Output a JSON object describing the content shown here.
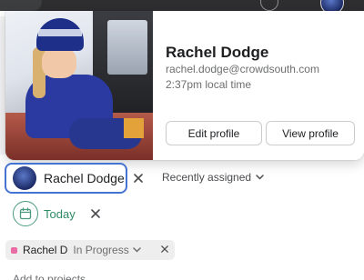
{
  "profile_card": {
    "name": "Rachel Dodge",
    "email": "rachel.dodge@crowdsouth.com",
    "local_time": "2:37pm local time",
    "edit_profile_label": "Edit profile",
    "view_profile_label": "View profile"
  },
  "assignee": {
    "name": "Rachel Dodge",
    "recently_assigned_label": "Recently assigned"
  },
  "due_date": {
    "label": "Today"
  },
  "project": {
    "name": "Rachel D",
    "status": "In Progress",
    "color": "#e96ca4"
  },
  "add_projects_label": "Add to projects",
  "colors": {
    "accent_blue": "#4573d2",
    "due_green": "#2e8a63"
  }
}
